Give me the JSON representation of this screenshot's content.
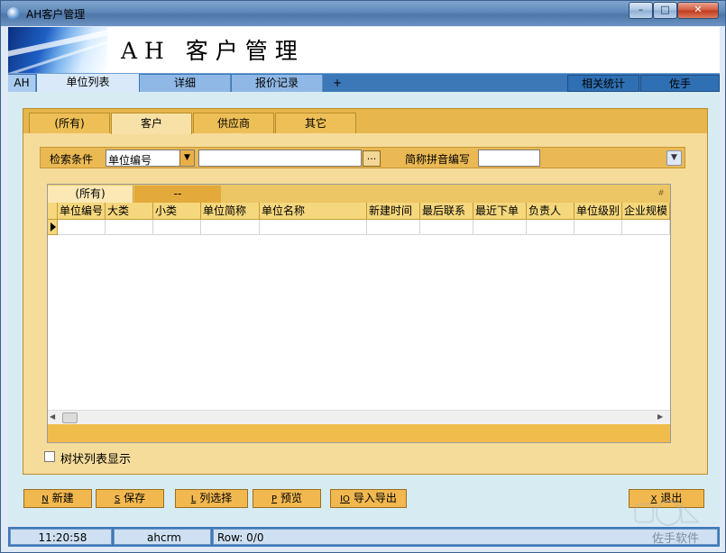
{
  "window": {
    "title": "AH客户管理",
    "minimize_glyph": "–",
    "maximize_glyph": "□",
    "close_glyph": "✕"
  },
  "banner": {
    "title": "AH 客户管理"
  },
  "main_tabs": {
    "ah": "AH",
    "items": [
      "单位列表",
      "详细",
      "报价记录"
    ],
    "plus": "+",
    "right": [
      "相关统计",
      "佐手"
    ]
  },
  "sub_tabs": [
    "(所有)",
    "客户",
    "供应商",
    "其它"
  ],
  "search": {
    "condition_label": "检索条件",
    "condition_value": "单位编号",
    "condition_value_input": "",
    "ellipsis": "...",
    "pinyin_label": "简称拼音编写",
    "pinyin_value": ""
  },
  "grid": {
    "tabs": [
      "(所有)",
      "--"
    ],
    "hash": "#",
    "columns": [
      "单位编号",
      "大类",
      "小类",
      "单位简称",
      "单位名称",
      "新建时间",
      "最后联系",
      "最近下单",
      "负责人",
      "单位级别",
      "企业规模"
    ]
  },
  "tree_toggle": {
    "label": "树状列表显示",
    "checked": false
  },
  "buttons": [
    {
      "key": "N",
      "label": "新建"
    },
    {
      "key": "S",
      "label": "保存"
    },
    {
      "key": "L",
      "label": "列选择"
    },
    {
      "key": "P",
      "label": "预览"
    },
    {
      "key": "IO",
      "label": "导入导出"
    }
  ],
  "exit_button": {
    "key": "X",
    "label": "退出"
  },
  "status": {
    "time": "11:20:58",
    "user": "ahcrm",
    "row": "Row: 0/0"
  },
  "watermark": {
    "text": "佐手软件"
  },
  "icons": {
    "app": "app-globe-icon",
    "dropdown": "chevron-down-icon",
    "scroll_left": "arrow-left-icon",
    "scroll_right": "arrow-right-icon",
    "row_pointer": "row-pointer-icon"
  },
  "colors": {
    "tab_strip": "#3c78b8",
    "panel": "#f6dc9a",
    "button": "#f2b850",
    "content_bg": "#d6ecf2"
  }
}
